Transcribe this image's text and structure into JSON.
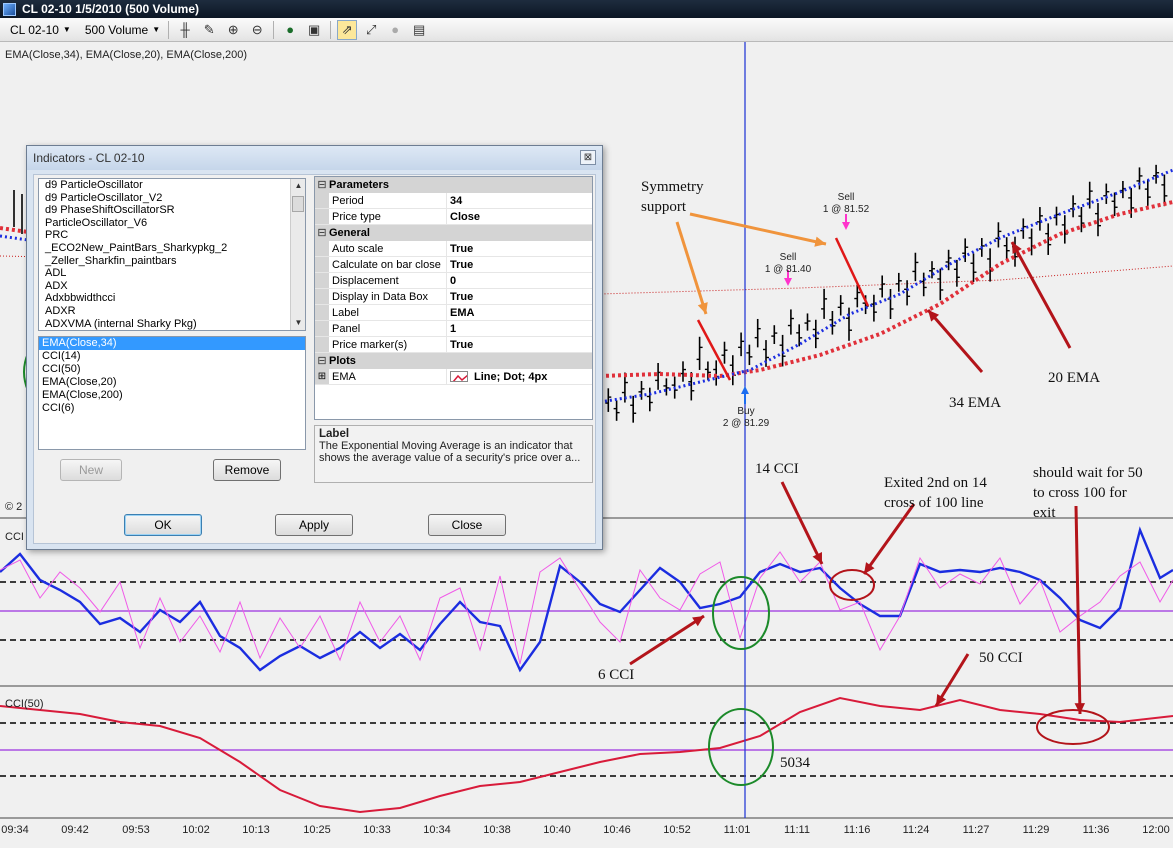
{
  "window": {
    "title": "CL 02-10  1/5/2010 (500 Volume)"
  },
  "toolbar": {
    "instrument": "CL 02-10",
    "interval": "500 Volume"
  },
  "chart": {
    "price_panel_label": "EMA(Close,34), EMA(Close,20), EMA(Close,200)",
    "cci14_panel_label": "CCI",
    "cci50_panel_label": "CCI(50)",
    "copyright_stub": "© 2",
    "time_axis": [
      "09:34",
      "09:42",
      "09:53",
      "10:02",
      "10:13",
      "10:25",
      "10:33",
      "10:34",
      "10:38",
      "10:40",
      "10:46",
      "10:52",
      "11:01",
      "11:11",
      "11:16",
      "11:24",
      "11:27",
      "11:29",
      "11:36",
      "12:00"
    ],
    "colors": {
      "ema34": "#e0303a",
      "ema20": "#1b2de0",
      "ema200": "#c81e1e",
      "cci14": "#1b2de0",
      "cci6": "#f05ae8",
      "cci50": "#d81b3a",
      "zero_line": "#9b30e0",
      "cursor": "#2a3fd6",
      "annot_arrow": "#b3141a",
      "annot_orange": "#f0943c",
      "ellipse_green": "#1c8a2a"
    }
  },
  "trades": {
    "sell1": {
      "label": "Sell",
      "detail": "1 @ 81.40"
    },
    "sell2": {
      "label": "Sell",
      "detail": "1 @ 81.52"
    },
    "buy": {
      "label": "Buy",
      "detail": "2 @ 81.29"
    }
  },
  "annotations": {
    "symmetry": "Symmetry\nsupport",
    "ema20": "20 EMA",
    "ema34": "34 EMA",
    "cci14": "14 CCI",
    "exited": "Exited 2nd on 14\ncross of 100 line",
    "should_wait": "should wait for 50\nto cross 100 for\nexit",
    "cci6": "6 CCI",
    "cci50": "50 CCI",
    "num5034": "5034"
  },
  "dialog": {
    "title": "Indicators - CL 02-10",
    "close_glyph": "⊠",
    "indicator_list": [
      "d9 ParticleOscillator",
      "d9 ParticleOscillator_V2",
      "d9 PhaseShiftOscillatorSR",
      "ParticleOscillator_V6",
      "PRC",
      "_ECO2New_PaintBars_Sharkypkg_2",
      "_Zeller_Sharkfin_paintbars",
      "ADL",
      "ADX",
      "Adxbbwidthcci",
      "ADXR",
      "ADXVMA (internal Sharky Pkg)"
    ],
    "applied_list": [
      "EMA(Close,34)",
      "CCI(14)",
      "CCI(50)",
      "EMA(Close,20)",
      "EMA(Close,200)",
      "CCI(6)"
    ],
    "new_label": "New",
    "remove_label": "Remove",
    "ok_label": "OK",
    "apply_label": "Apply",
    "close_label": "Close",
    "properties": {
      "parameters_header": "Parameters",
      "general_header": "General",
      "plots_header": "Plots",
      "parameters": [
        {
          "name": "Period",
          "value": "34"
        },
        {
          "name": "Price type",
          "value": "Close"
        }
      ],
      "general": [
        {
          "name": "Auto scale",
          "value": "True"
        },
        {
          "name": "Calculate on bar close",
          "value": "True"
        },
        {
          "name": "Displacement",
          "value": "0"
        },
        {
          "name": "Display in Data Box",
          "value": "True"
        },
        {
          "name": "Label",
          "value": "EMA"
        },
        {
          "name": "Panel",
          "value": "1"
        },
        {
          "name": "Price marker(s)",
          "value": "True"
        }
      ],
      "plots": [
        {
          "name": "EMA",
          "value": "Line; Dot; 4px"
        }
      ]
    },
    "help": {
      "title": "Label",
      "text": "The Exponential Moving Average is an indicator that shows the average value of a security's price over a..."
    }
  }
}
